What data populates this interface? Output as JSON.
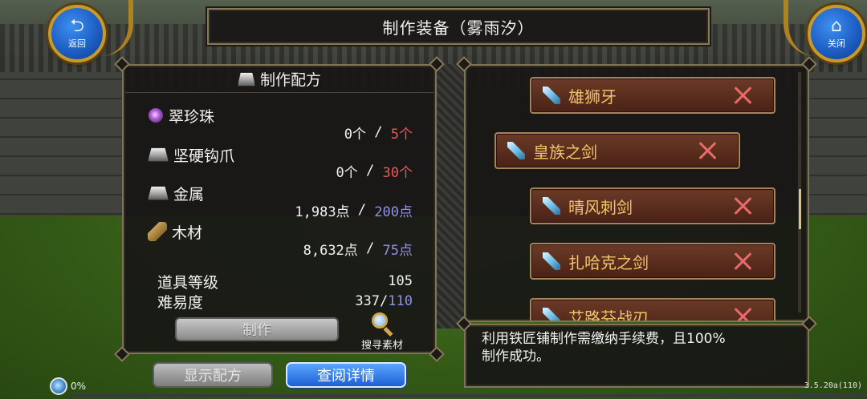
{
  "window": {
    "title": "制作装备（雾雨汐）"
  },
  "nav": {
    "back": {
      "icon": "back-arrow-icon",
      "label": "返回"
    },
    "close": {
      "icon": "home-icon",
      "label": "关闭"
    }
  },
  "recipe": {
    "header": "制作配方",
    "header_icon": "toolbox-icon",
    "materials": [
      {
        "name": "翠珍珠",
        "icon": "orb-icon",
        "have": "0个",
        "need": "5个",
        "need_color": "#e85a5a"
      },
      {
        "name": "坚硬钩爪",
        "icon": "ingot-icon",
        "have": "0个",
        "need": "30个",
        "need_color": "#e85a5a"
      },
      {
        "name": "金属",
        "icon": "ingot-icon",
        "have": "1,983点",
        "need": "200点",
        "need_color": "#8f8ff0"
      },
      {
        "name": "木材",
        "icon": "wood-icon",
        "have": "8,632点",
        "need": "75点",
        "need_color": "#8f8ff0"
      }
    ],
    "item_level_label": "道具等级",
    "item_level": "105",
    "difficulty_label": "难易度",
    "difficulty_have": "337",
    "difficulty_need": "110"
  },
  "actions": {
    "craft": "制作",
    "search_materials": "搜寻素材",
    "show_recipe": "显示配方",
    "view_details": "查阅详情"
  },
  "equipment_list": [
    {
      "name": "雄狮牙"
    },
    {
      "name": "皇族之剑",
      "selected": true
    },
    {
      "name": "晴风刺剑"
    },
    {
      "name": "扎哈克之剑"
    },
    {
      "name": "艾路芬战刃"
    }
  ],
  "info": {
    "line1": "利用铁匠铺制作需缴纳手续费，且100%",
    "line2": "制作成功。"
  },
  "status": {
    "exp_percent": "0%",
    "version": "3.5.20a(110)"
  },
  "colors": {
    "accent_gold": "#c89a2c",
    "item_name": "#f3c36a",
    "need_red": "#e85a5a",
    "need_blue": "#8f8ff0",
    "primary_button": "#1d5fd4"
  }
}
